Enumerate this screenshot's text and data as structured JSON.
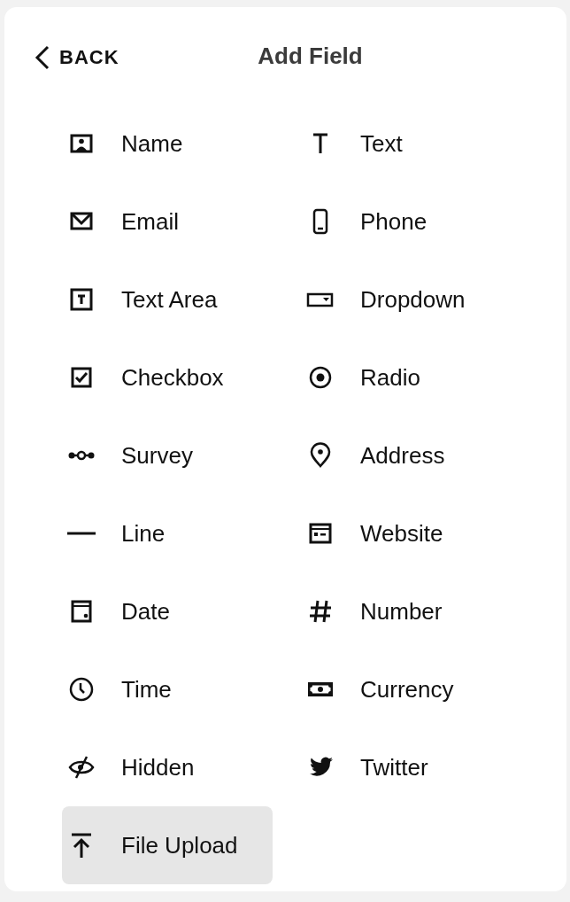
{
  "header": {
    "back": "BACK",
    "title": "Add Field"
  },
  "fields": [
    {
      "label": "Name",
      "kind": "name",
      "selected": false
    },
    {
      "label": "Text",
      "kind": "text",
      "selected": false
    },
    {
      "label": "Email",
      "kind": "email",
      "selected": false
    },
    {
      "label": "Phone",
      "kind": "phone",
      "selected": false
    },
    {
      "label": "Text Area",
      "kind": "textarea",
      "selected": false
    },
    {
      "label": "Dropdown",
      "kind": "dropdown",
      "selected": false
    },
    {
      "label": "Checkbox",
      "kind": "checkbox",
      "selected": false
    },
    {
      "label": "Radio",
      "kind": "radio",
      "selected": false
    },
    {
      "label": "Survey",
      "kind": "survey",
      "selected": false
    },
    {
      "label": "Address",
      "kind": "address",
      "selected": false
    },
    {
      "label": "Line",
      "kind": "line",
      "selected": false
    },
    {
      "label": "Website",
      "kind": "website",
      "selected": false
    },
    {
      "label": "Date",
      "kind": "date",
      "selected": false
    },
    {
      "label": "Number",
      "kind": "number",
      "selected": false
    },
    {
      "label": "Time",
      "kind": "time",
      "selected": false
    },
    {
      "label": "Currency",
      "kind": "currency",
      "selected": false
    },
    {
      "label": "Hidden",
      "kind": "hidden",
      "selected": false
    },
    {
      "label": "Twitter",
      "kind": "twitter",
      "selected": false
    },
    {
      "label": "File Upload",
      "kind": "upload",
      "selected": true
    }
  ]
}
